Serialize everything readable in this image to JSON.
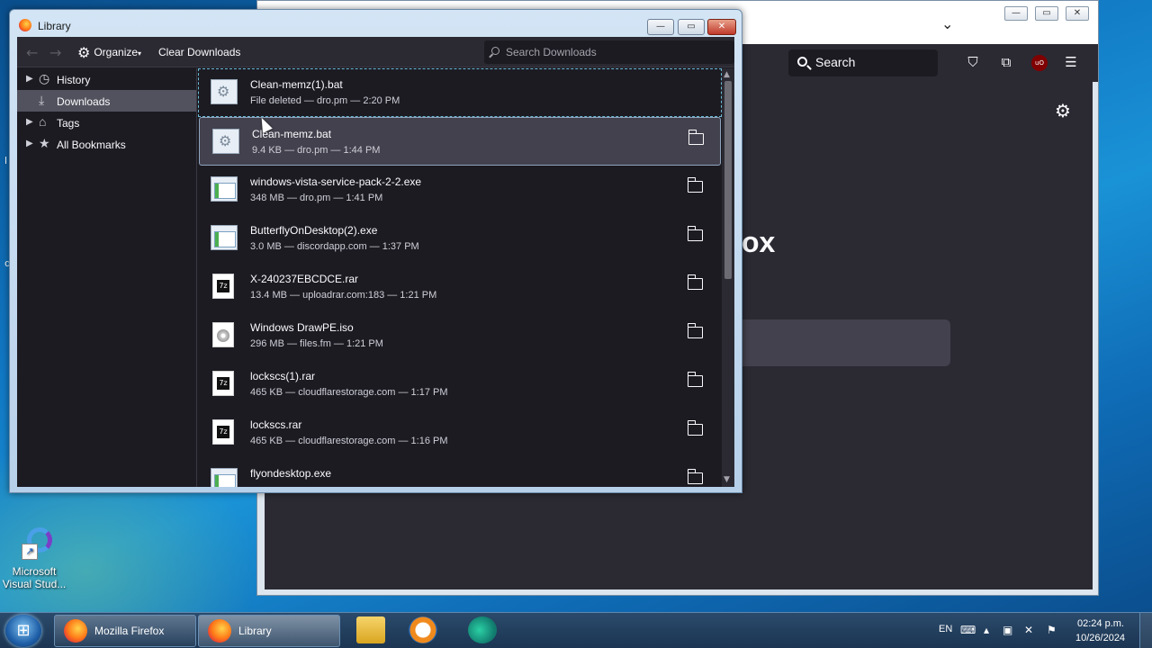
{
  "desktop": {
    "icon_label": "Microsoft Visual Stud..."
  },
  "firefox": {
    "search_label": "Search",
    "brand_fragment": "ox"
  },
  "library": {
    "title": "Library",
    "toolbar": {
      "organize_label": "Organize",
      "clear_downloads_label": "Clear Downloads",
      "search_placeholder": "Search Downloads"
    },
    "sidebar": [
      {
        "label": "History",
        "icon": "clock-icon",
        "expandable": true
      },
      {
        "label": "Downloads",
        "icon": "download-icon",
        "expandable": false,
        "selected": true
      },
      {
        "label": "Tags",
        "icon": "tag-icon",
        "expandable": true
      },
      {
        "label": "All Bookmarks",
        "icon": "star-icon",
        "expandable": true
      }
    ],
    "downloads": [
      {
        "name": "Clean-memz(1).bat",
        "meta": "File deleted — dro.pm — 2:20 PM",
        "type": "bat",
        "state": "focused",
        "folder": false
      },
      {
        "name": "Clean-memz.bat",
        "meta": "9.4 KB — dro.pm — 1:44 PM",
        "type": "bat",
        "state": "selected",
        "folder": true
      },
      {
        "name": "windows-vista-service-pack-2-2.exe",
        "meta": "348 MB — dro.pm — 1:41 PM",
        "type": "exe",
        "state": "",
        "folder": true
      },
      {
        "name": "ButterflyOnDesktop(2).exe",
        "meta": "3.0 MB — discordapp.com — 1:37 PM",
        "type": "exe",
        "state": "",
        "folder": true
      },
      {
        "name": "X-240237EBCDCE.rar",
        "meta": "13.4 MB — uploadrar.com:183 — 1:21 PM",
        "type": "rar",
        "state": "",
        "folder": true
      },
      {
        "name": "Windows DrawPE.iso",
        "meta": "296 MB — files.fm — 1:21 PM",
        "type": "iso",
        "state": "",
        "folder": true
      },
      {
        "name": "lockscs(1).rar",
        "meta": "465 KB — cloudflarestorage.com — 1:17 PM",
        "type": "rar",
        "state": "",
        "folder": true
      },
      {
        "name": "lockscs.rar",
        "meta": "465 KB — cloudflarestorage.com — 1:16 PM",
        "type": "rar",
        "state": "",
        "folder": true
      },
      {
        "name": "flyondesktop.exe",
        "meta": "",
        "type": "exe",
        "state": "",
        "folder": true
      }
    ]
  },
  "taskbar": {
    "buttons": [
      {
        "label": "Mozilla Firefox",
        "active": false
      },
      {
        "label": "Library",
        "active": true
      }
    ],
    "language": "EN",
    "time": "02:24 p.m.",
    "date": "10/26/2024"
  }
}
